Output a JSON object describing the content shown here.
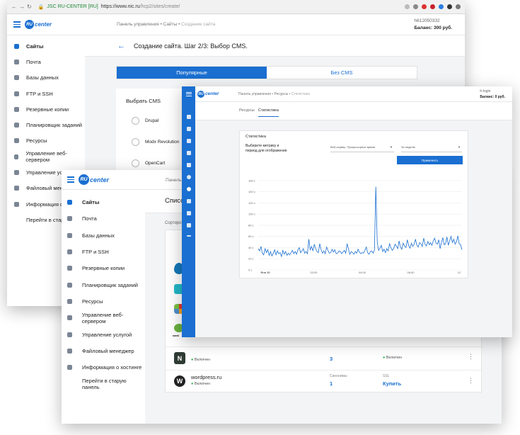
{
  "browser": {
    "secure_label": "JSC RU-CENTER [RU]",
    "url_host": "https://www.nic.ru",
    "url_path": "/hcp2/sites/create/"
  },
  "brand": {
    "logo_ru": "RU",
    "logo_center": "center",
    "color": "#1a6fd1"
  },
  "back_window": {
    "breadcrumb": [
      "Панель управления",
      "Сайты",
      "Создание сайта"
    ],
    "account_id": "h612050332",
    "balance": "Баланс: 300 руб.",
    "page_title": "Создание сайта. Шаг 2/3: Выбор CMS.",
    "tabs": [
      {
        "label": "Популярные",
        "active": true
      },
      {
        "label": "Без CMS",
        "active": false
      }
    ],
    "cms_label": "Выбрать CMS",
    "cms_options": [
      "Drupal",
      "Modx Revolution",
      "OpenCart"
    ],
    "sidebar": [
      {
        "label": "Сайты",
        "icon": "sites-icon"
      },
      {
        "label": "Почта",
        "icon": "mail-icon"
      },
      {
        "label": "Базы данных",
        "icon": "database-icon"
      },
      {
        "label": "FTP и SSH",
        "icon": "ftp-icon"
      },
      {
        "label": "Резервные копии",
        "icon": "backup-icon"
      },
      {
        "label": "Планировщик заданий",
        "icon": "scheduler-icon"
      },
      {
        "label": "Ресурсы",
        "icon": "resources-icon"
      },
      {
        "label": "Управление веб-сервером",
        "icon": "webserver-icon"
      },
      {
        "label": "Управление услугой",
        "icon": "service-icon"
      },
      {
        "label": "Файловый менедж",
        "icon": "folder-icon"
      },
      {
        "label": "Информация о хостин",
        "icon": "info-icon"
      },
      {
        "label": "Перейти в старую",
        "icon": ""
      }
    ]
  },
  "mid_window": {
    "breadcrumb_fragment": "Панель",
    "list_title_fragment": "Списо",
    "sort_label_fragment": "Сортиров",
    "sidebar": [
      {
        "label": "Сайты",
        "icon": "sites-icon"
      },
      {
        "label": "Почта",
        "icon": "mail-icon"
      },
      {
        "label": "Базы данных",
        "icon": "database-icon"
      },
      {
        "label": "FTP и SSH",
        "icon": "ftp-icon"
      },
      {
        "label": "Резервные копии",
        "icon": "backup-icon"
      },
      {
        "label": "Планировщик заданий",
        "icon": "scheduler-icon"
      },
      {
        "label": "Ресурсы",
        "icon": "resources-icon"
      },
      {
        "label": "Управление веб-сервером",
        "icon": "webserver-icon"
      },
      {
        "label": "Управление услугой",
        "icon": "service-icon"
      },
      {
        "label": "Файловый менеджер",
        "icon": "folder-icon"
      },
      {
        "label": "Информация о хостинге",
        "icon": "info-icon"
      },
      {
        "label": "Перейти в старую панель",
        "icon": ""
      }
    ],
    "site_rows": [
      {
        "name": "",
        "status": "Включен",
        "synonyms_label": "",
        "synonyms": "3",
        "ssl_label": "",
        "ssl": "Включен",
        "logo": "nginx-n"
      },
      {
        "name": "wordpress.ru",
        "status": "Включен",
        "synonyms_label": "Синонимы",
        "synonyms": "1",
        "ssl_label": "SSL",
        "ssl": "Купить",
        "logo": "wordpress"
      }
    ],
    "partial_logos": [
      "drupal",
      "cyan",
      "joomla",
      "mobile"
    ],
    "partial_logo_text": "мові"
  },
  "front_window": {
    "breadcrumb": [
      "Панель управления",
      "Ресурсы",
      "Статистика"
    ],
    "account_id": "h-login",
    "balance": "Баланс: 0 руб.",
    "tabs": [
      {
        "label": "Ресурсы",
        "active": false
      },
      {
        "label": "Статистика",
        "active": true
      }
    ],
    "card_title": "Статистика",
    "metric_prompt": [
      "Выберите метрику и",
      "период для отображения"
    ],
    "metric_select": "Веб-сервер. Процессорное время",
    "period_select": "За неделю",
    "apply_button": "Применить"
  },
  "chart_data": {
    "type": "line",
    "color": "#1a6fd1",
    "ylim": [
      0,
      170
    ],
    "y_ticks": [
      0,
      20,
      40,
      60,
      80,
      100,
      120,
      140,
      160
    ],
    "y_tick_labels": [
      "0 с",
      "20 с",
      "40 с",
      "60 с",
      "80 с",
      "100 с",
      "120 с",
      "140 с",
      "160 с"
    ],
    "x_tick_labels": [
      "Янв 30",
      "02:00",
      "04:00",
      "06:00",
      "12"
    ],
    "values": [
      38,
      34,
      42,
      30,
      27,
      38,
      31,
      36,
      26,
      33,
      25,
      30,
      36,
      27,
      34,
      29,
      31,
      24,
      35,
      28,
      33,
      26,
      30,
      27,
      31,
      35,
      29,
      33,
      28,
      36,
      40,
      31,
      34,
      38,
      30,
      33,
      29,
      55,
      36,
      42,
      34,
      46,
      38,
      33,
      31,
      47,
      36,
      30,
      34,
      29,
      41,
      35,
      30,
      31,
      37,
      32,
      36,
      29,
      30,
      34,
      33,
      29,
      32,
      35,
      30,
      47,
      37,
      28,
      33,
      31,
      28,
      33,
      30,
      37,
      32,
      29,
      31,
      30,
      35,
      41,
      31,
      28,
      33,
      34,
      30,
      36,
      149,
      50,
      35,
      39,
      44,
      33,
      37,
      31,
      38,
      34,
      47,
      40,
      35,
      38,
      46,
      43,
      38,
      52,
      41,
      37,
      48,
      43,
      40,
      54,
      44,
      39,
      48,
      42,
      46,
      55,
      44,
      41,
      49,
      47,
      42,
      57,
      46,
      43,
      51,
      45,
      49,
      44,
      52,
      57,
      48,
      46,
      54,
      38,
      49,
      58,
      45,
      47,
      59,
      44,
      52,
      60,
      49,
      55,
      46,
      51,
      61,
      47,
      45,
      36
    ]
  }
}
